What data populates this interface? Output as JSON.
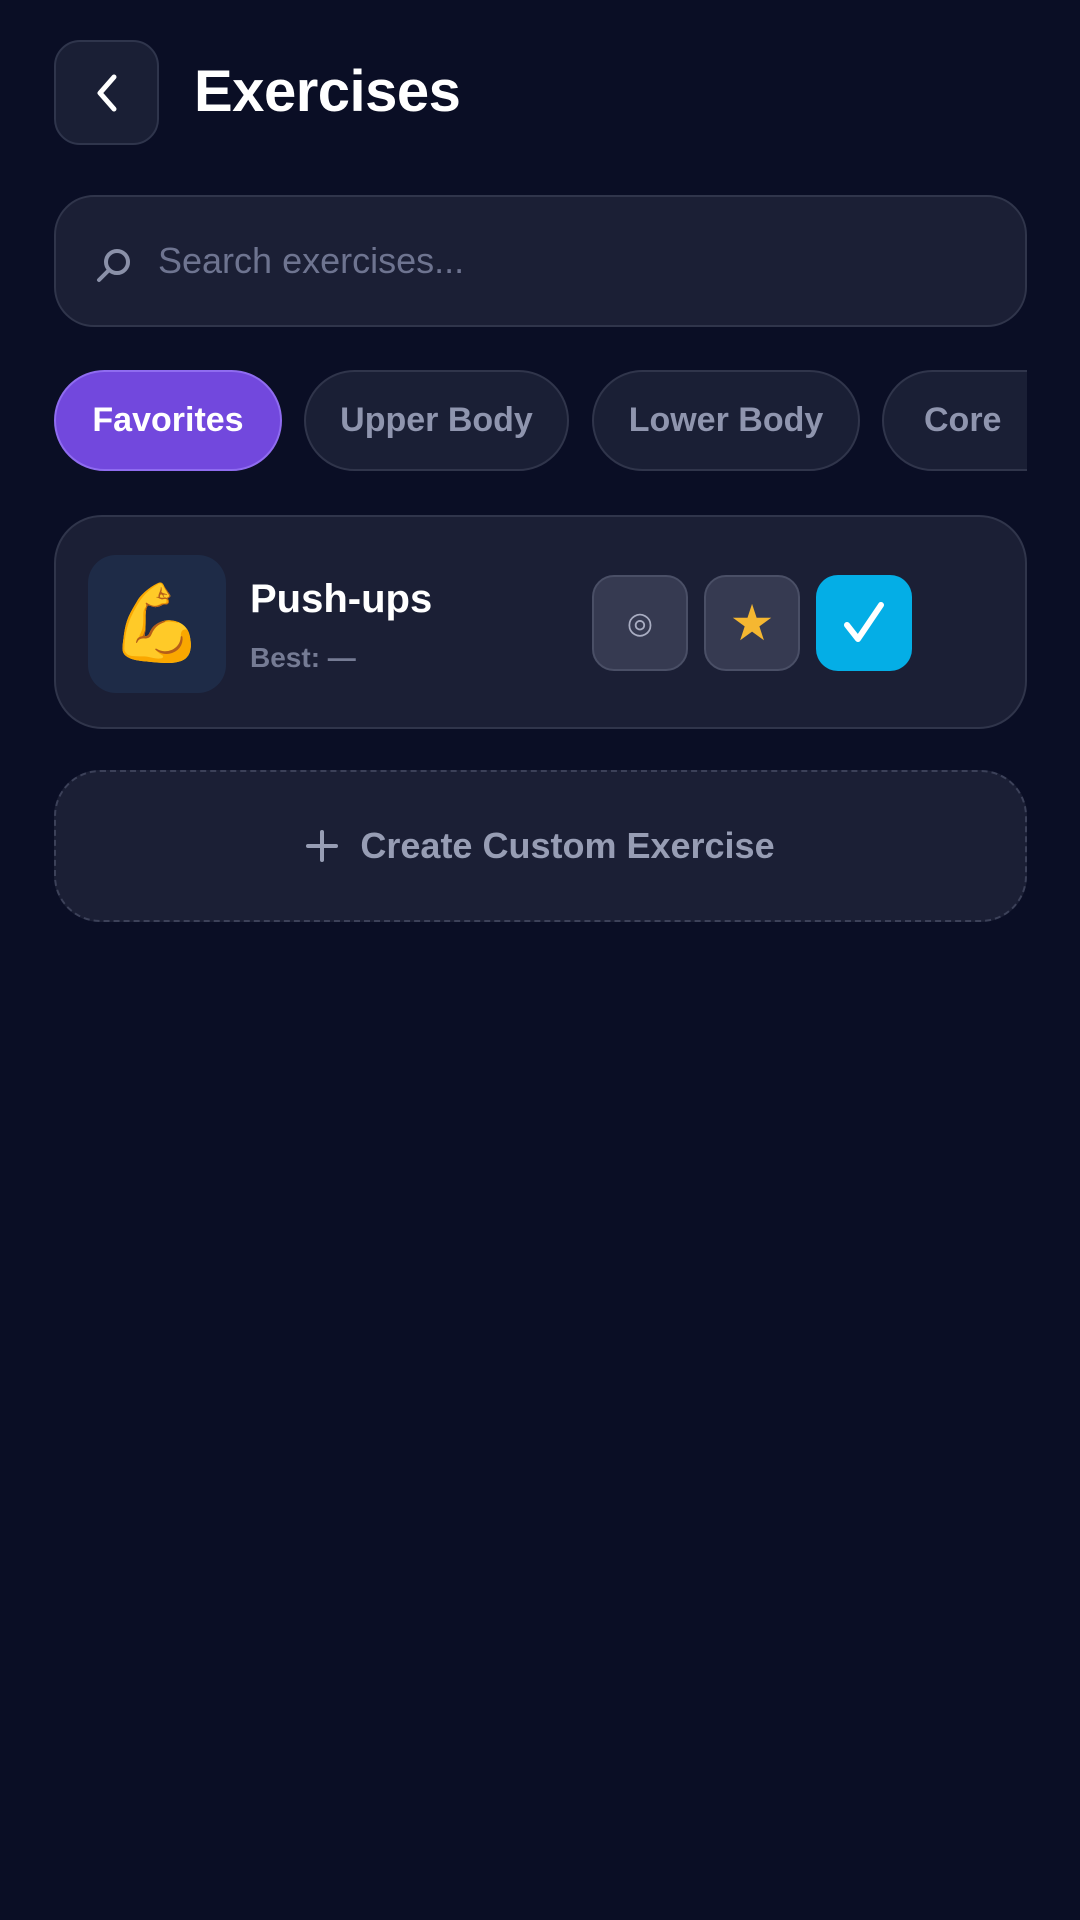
{
  "header": {
    "title": "Exercises",
    "back_icon": "chevron-left-icon"
  },
  "search": {
    "placeholder": "Search exercises...",
    "value": "",
    "icon": "search-icon"
  },
  "filters": [
    {
      "label": "Favorites",
      "active": true
    },
    {
      "label": "Upper Body",
      "active": false
    },
    {
      "label": "Lower Body",
      "active": false
    },
    {
      "label": "Core",
      "active": false
    }
  ],
  "exercises": [
    {
      "name": "Push-ups",
      "best": "Best: —",
      "icon": "💪",
      "actions": [
        {
          "icon": "target-icon",
          "glyph": "◎"
        },
        {
          "icon": "star-icon",
          "glyph": "★"
        },
        {
          "icon": "check-icon",
          "selected": true
        }
      ]
    }
  ],
  "create_button": {
    "label": "Create Custom Exercise",
    "icon": "plus-icon"
  },
  "colors": {
    "background": "#0a0e25",
    "card": "#1b1f35",
    "accent_purple": "#7248dd",
    "accent_cyan": "#04aee6",
    "star": "#f5b731"
  }
}
